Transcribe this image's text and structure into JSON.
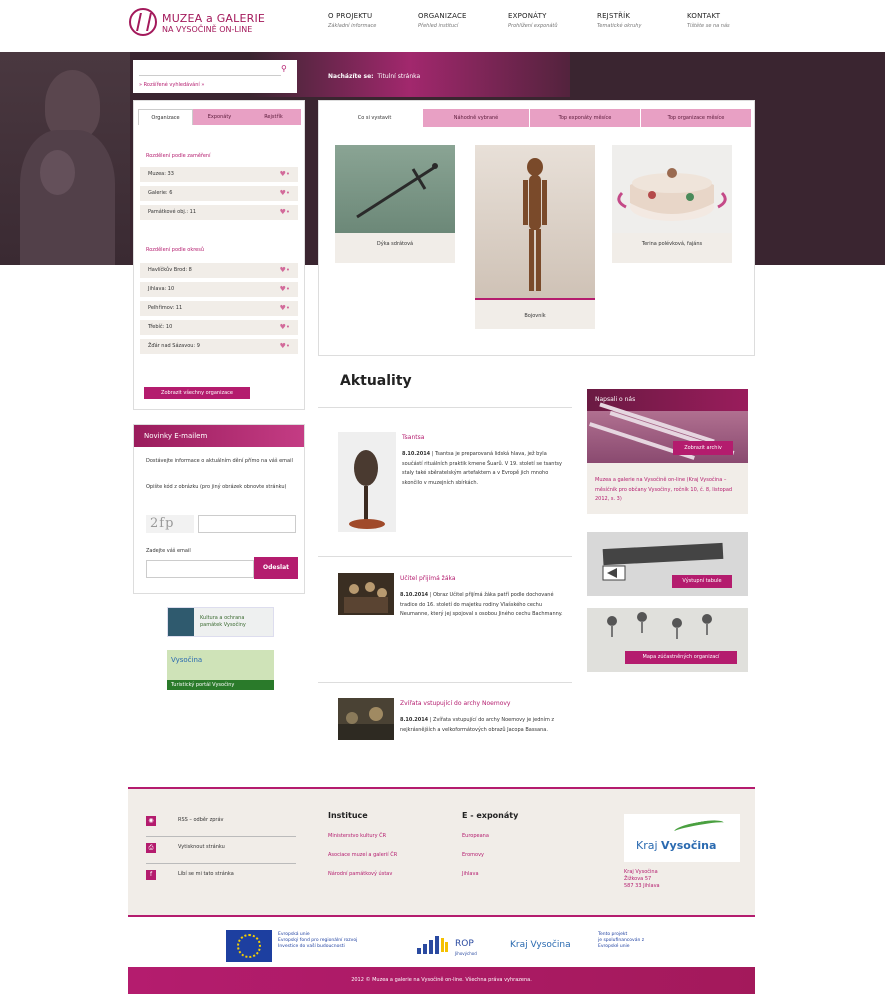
{
  "logo": {
    "line1": "MUZEA a GALERIE",
    "line2": "NA VYSOČINĚ ON-LINE"
  },
  "nav": [
    {
      "title": "O PROJEKTU",
      "sub": "Základní informace"
    },
    {
      "title": "ORGANIZACE",
      "sub": "Přehled institucí"
    },
    {
      "title": "EXPONÁTY",
      "sub": "Prohlížení exponátů"
    },
    {
      "title": "REJSTŘÍK",
      "sub": "Tematické okruhy"
    },
    {
      "title": "KONTAKT",
      "sub": "Tištěte se na nás"
    }
  ],
  "search": {
    "placeholder": "",
    "advanced": "» Rozšířené vyhledávání »"
  },
  "breadcrumb": {
    "label": "Nacházíte se:",
    "current": "Titulní stránka"
  },
  "left_tabs": [
    "Organizace",
    "Exponáty",
    "Rejstřík"
  ],
  "by_focus": {
    "title": "Rozdělení podle zaměření",
    "items": [
      "Muzea: 33",
      "Galerie: 6",
      "Památkové obj.: 11"
    ]
  },
  "by_region": {
    "title": "Rozdělení podle okresů",
    "items": [
      "Havlíčkův Brod: 8",
      "Jihlava: 10",
      "Pelhřimov: 11",
      "Třebíč: 10",
      "Žďár nad Sázavou: 9"
    ]
  },
  "show_all": "Zobrazit všechny organizace",
  "newsletter": {
    "title": "Novinky E-mailem",
    "text1": "Dostávejte informace o aktuálním dění přímo na váš email",
    "text2": "Opište kód z obrázku (pro jiný obrázek obnovte stránku)",
    "captcha": "2fp",
    "email_label": "Zadejte váš email",
    "send": "Odeslat"
  },
  "side_logos": {
    "kultura": "Kultura a ochrana\npamátek Vysočiny",
    "vys_title": "Vysočina",
    "vys_bar": "Turistický portál Vysočiny"
  },
  "exh_tabs": [
    "Co si vystavit",
    "Náhodně vybrané",
    "Top exponáty měsíce",
    "Top organizace měsíce"
  ],
  "exhibits": [
    {
      "caption": "Dýka sdrátová"
    },
    {
      "caption": "Bojovník"
    },
    {
      "caption": "Terina polévková, fajáns"
    }
  ],
  "news": {
    "title": "Aktuality",
    "items": [
      {
        "headline": "Tsantsa",
        "date": "8.10.2014",
        "body": "Tsantsa je preparovaná lidská hlava, jež byla součástí rituálních praktik kmene Šuarů. V 19. století se tsantsy staly také sběratelským artefaktem a v Evropě jich mnoho skončilo v muzejních sbírkách."
      },
      {
        "headline": "Učitel přijímá žáka",
        "date": "8.10.2014",
        "body": "Obraz Učitel přijímá žáka patří podle dochované tradice do 16. století do majetku rodiny Vlašského cechu Neumanne, který jej spojoval s osobou Jiného cechu Bachmanny."
      },
      {
        "headline": "Zvířata vstupující do archy Noemovy",
        "date": "8.10.2014",
        "body": "Zvířata vstupující do archy Noemovy je jedním z nejkrásnějších a velkoformátových obrazů Jacopa Bassana."
      }
    ]
  },
  "write_us": {
    "title": "Napsali o nás",
    "button": "Zobrazit archiv",
    "text": "Muzea a galerie na Vysočině on-line (Kraj Vysočina – měsíčník pro občany Vysočiny, ročník 10, č. 8, listopad 2012, s. 3)"
  },
  "sign_btn": "Výstupní tabule",
  "map_btn": "Mapa zúčastněných organizací",
  "footer": {
    "links": [
      "RSS – odběr zpráv",
      "Vytisknout stránku",
      "Líbí se mi tato stránka"
    ],
    "col1_title": "Instituce",
    "col1_links": [
      "Ministerstvo kultury ČR",
      "Asociace muzeí a galerií ČR",
      "Národní památkový ústav"
    ],
    "col2_title": "E - exponáty",
    "col2_links": [
      "Europeana",
      "Eromovy",
      "Jihlava"
    ],
    "kraj_logo": {
      "a": "Kraj ",
      "b": "Vysočina"
    },
    "kraj_addr": "Kraj Vysočina\nŽižkova 57\n587 33 Jihlava"
  },
  "eu": {
    "text1": "Evropská unie\nEvropský fond pro regionální rozvoj\nInvestice do vaší budoucnosti",
    "rop": "ROP",
    "rop_sub": "Jihovýchod",
    "kraj": "Kraj Vysočina",
    "text2": "Tento projekt\nje spolufinancován z\nEvropské unie"
  },
  "bottom": "2012 © Muzea a galerie na Vysočině on-line. Všechna práva vyhrazena."
}
